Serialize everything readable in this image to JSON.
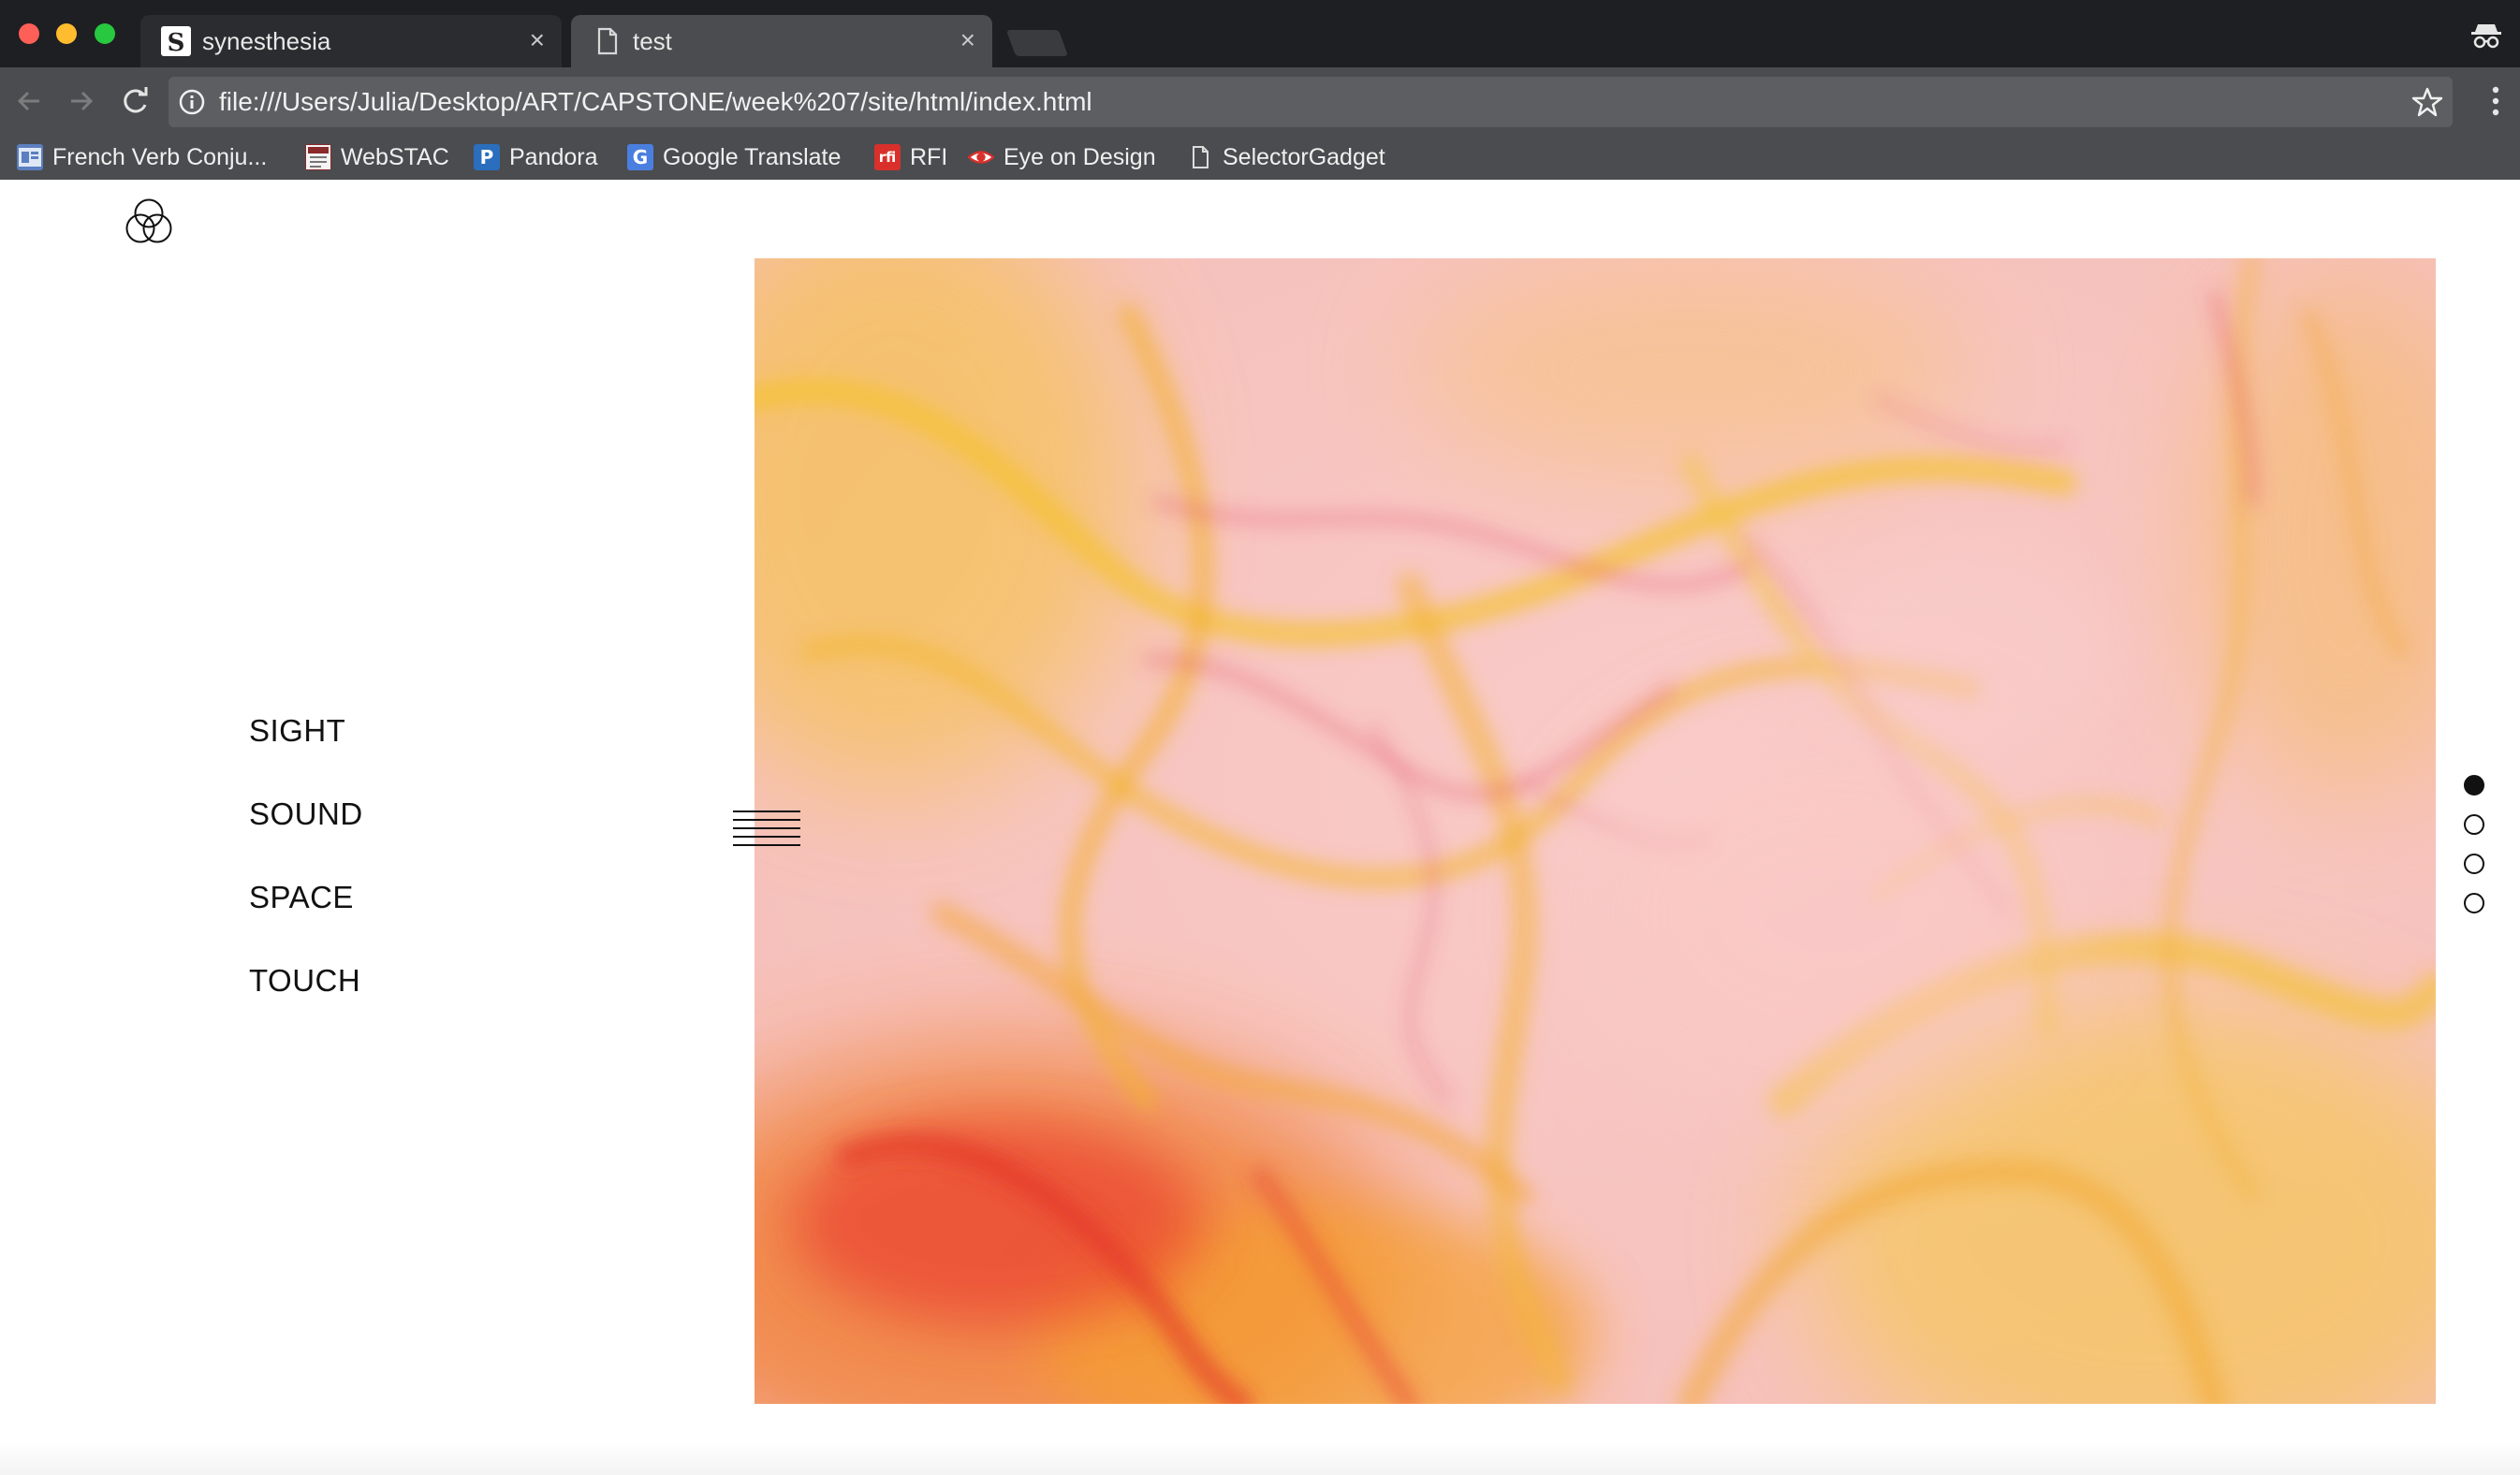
{
  "tabs": [
    {
      "title": "synesthesia",
      "favicon": "S",
      "active": false
    },
    {
      "title": "test",
      "favicon": "page-icon",
      "active": true
    }
  ],
  "tab_close_symbol": "×",
  "address_bar": {
    "url": "file:///Users/Julia/Desktop/ART/CAPSTONE/week%207/site/html/index.html"
  },
  "bookmarks": [
    {
      "label": "French Verb Conju...",
      "icon": "fr-icon",
      "color": "#5b7fbf"
    },
    {
      "label": "WebSTAC",
      "icon": "webstac-icon",
      "color": "#8a2a2a"
    },
    {
      "label": "Pandora",
      "icon": "P",
      "color": "#2a6ebd"
    },
    {
      "label": "Google Translate",
      "icon": "G",
      "color": "#4a7fe0"
    },
    {
      "label": "RFI",
      "icon": "rfi",
      "color": "#d9302b"
    },
    {
      "label": "Eye on Design",
      "icon": "eye-icon",
      "color": "#d9302b"
    },
    {
      "label": "SelectorGadget",
      "icon": "page-icon",
      "color": "#cccccc"
    }
  ],
  "site": {
    "nav": [
      "SIGHT",
      "SOUND",
      "SPACE",
      "TOUCH"
    ],
    "carousel": {
      "slides": 4,
      "active_index": 0
    }
  },
  "colors": {
    "tabbar_bg": "#1e1f22",
    "toolbar_bg": "#4b4c4f",
    "hero_pink": "#f7c3c2",
    "hero_yellow": "#f5c630",
    "hero_orange": "#f07a2a",
    "hero_red": "#e8394a"
  }
}
